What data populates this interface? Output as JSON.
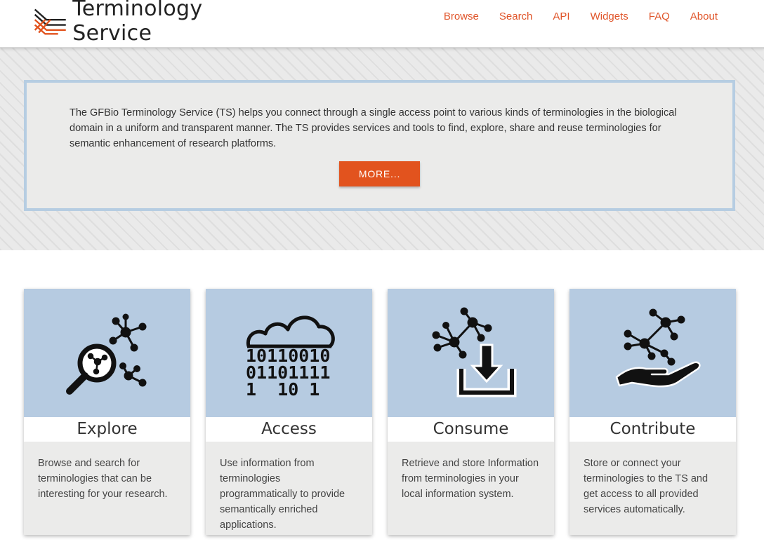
{
  "header": {
    "brand": "Terminology Service",
    "logo_icon": "stacked-lines-logo-icon",
    "nav": [
      "Browse",
      "Search",
      "API",
      "Widgets",
      "FAQ",
      "About"
    ]
  },
  "intro": {
    "text": "The GFBio Terminology Service (TS) helps you connect through a single access point to various kinds of terminologies in the biological domain in a uniform and transparent manner. The TS provides services and tools to find, explore, share and reuse terminologies for semantic enhancement of research platforms.",
    "button": "MORE..."
  },
  "cards": [
    {
      "title": "Explore",
      "icon": "magnifier-network-icon",
      "text": "Browse and search for terminologies that can be interesting for your research."
    },
    {
      "title": "Access",
      "icon": "cloud-binary-icon",
      "text": "Use information from terminologies programmatically to provide semantically enriched applications."
    },
    {
      "title": "Consume",
      "icon": "network-download-icon",
      "text": "Retrieve and store Information from terminologies in your local information system."
    },
    {
      "title": "Contribute",
      "icon": "hand-network-icon",
      "text": "Store or connect your terminologies to the TS and get access to all provided services automatically."
    }
  ],
  "access_binary": [
    "10110010",
    "01101111",
    "1  10 1"
  ],
  "colors": {
    "accent": "#e2531e",
    "nav_link": "#e0552a",
    "card_header": "#b6cbe1",
    "intro_border": "#b6cde2"
  }
}
